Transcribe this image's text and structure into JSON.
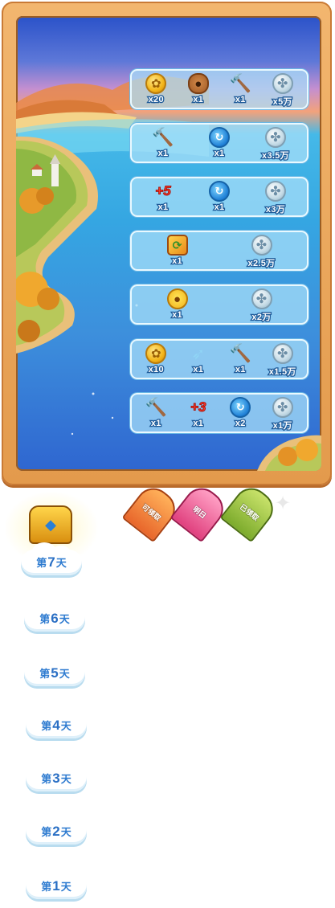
{
  "rewards": [
    {
      "items": [
        {
          "icon": "coin-icon",
          "glyph": "✿",
          "qty": "x20"
        },
        {
          "icon": "bear-icon",
          "glyph": "●",
          "qty": "x1"
        },
        {
          "icon": "hammer-icon",
          "glyph": "🔨",
          "qty": "x1"
        },
        {
          "icon": "clover-icon",
          "glyph": "✤",
          "qty": "x5万"
        }
      ]
    },
    {
      "items": [
        {
          "icon": "hammer-icon",
          "glyph": "🔨",
          "qty": "x1"
        },
        {
          "icon": "potion-icon",
          "glyph": "↻",
          "qty": "x1"
        },
        {
          "icon": "clover-icon",
          "glyph": "✤",
          "qty": "x3.5万"
        }
      ]
    },
    {
      "items": [
        {
          "icon": "plus-icon",
          "glyph": "+5",
          "qty": "x1"
        },
        {
          "icon": "potion-icon",
          "glyph": "↻",
          "qty": "x1"
        },
        {
          "icon": "clover-icon",
          "glyph": "✤",
          "qty": "x3万"
        }
      ]
    },
    {
      "items": [
        {
          "icon": "board-icon",
          "glyph": "⟳",
          "qty": "x1"
        },
        {
          "icon": "clover-icon",
          "glyph": "✤",
          "qty": "x2.5万"
        }
      ]
    },
    {
      "items": [
        {
          "icon": "chick-icon",
          "glyph": "●",
          "qty": "x1"
        },
        {
          "icon": "clover-icon",
          "glyph": "✤",
          "qty": "x2万"
        }
      ]
    },
    {
      "items": [
        {
          "icon": "coin-icon",
          "glyph": "✿",
          "qty": "x10"
        },
        {
          "icon": "shuttle-icon",
          "glyph": "➶",
          "qty": "x1"
        },
        {
          "icon": "hammer-icon",
          "glyph": "🔨",
          "qty": "x1"
        },
        {
          "icon": "clover-icon",
          "glyph": "✤",
          "qty": "x1.5万"
        }
      ]
    },
    {
      "items": [
        {
          "icon": "hammer-icon",
          "glyph": "🔨",
          "qty": "x1"
        },
        {
          "icon": "plus-icon",
          "glyph": "+3",
          "qty": "x1"
        },
        {
          "icon": "potion-icon",
          "glyph": "↻",
          "qty": "x2"
        },
        {
          "icon": "clover-icon",
          "glyph": "✤",
          "qty": "x1万"
        }
      ]
    }
  ],
  "ribbons": {
    "claimable": "可领取",
    "tomorrow": "明日",
    "claimed": "已领取"
  },
  "days": [
    {
      "prefix": "第",
      "num": "7",
      "suffix": "天"
    },
    {
      "prefix": "第",
      "num": "6",
      "suffix": "天"
    },
    {
      "prefix": "第",
      "num": "5",
      "suffix": "天"
    },
    {
      "prefix": "第",
      "num": "4",
      "suffix": "天"
    },
    {
      "prefix": "第",
      "num": "3",
      "suffix": "天"
    },
    {
      "prefix": "第",
      "num": "2",
      "suffix": "天"
    },
    {
      "prefix": "第",
      "num": "1",
      "suffix": "天"
    }
  ],
  "colors": {
    "frame": "#e8a455",
    "water": "#35a6e2",
    "label_blue": "#2e7bd0"
  }
}
